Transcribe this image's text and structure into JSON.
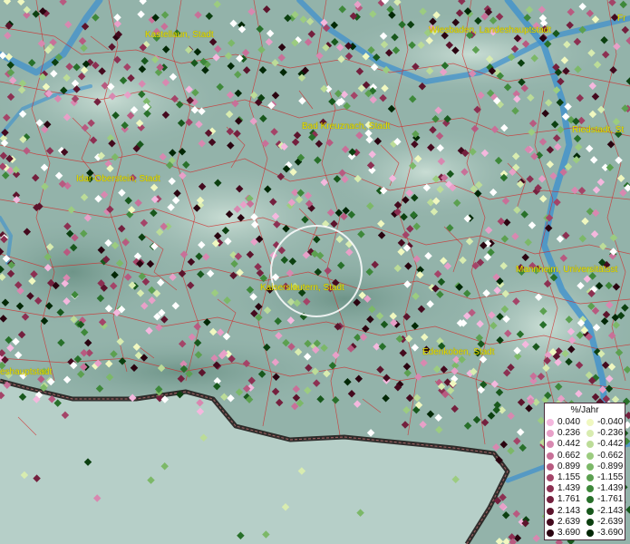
{
  "map": {
    "places": [
      {
        "id": "kastellaun",
        "label": "Kastellaun, Stadt"
      },
      {
        "id": "wiesbaden",
        "label": "Wiesbaden, Landeshauptstadt"
      },
      {
        "id": "frankfurt",
        "label": "Fr"
      },
      {
        "id": "bad-kreuznach",
        "label": "Bad Kreuznach, Stadt"
      },
      {
        "id": "riedstadt",
        "label": "Riedstadt, St"
      },
      {
        "id": "idar-oberstein",
        "label": "Idar-Oberstein, Stadt"
      },
      {
        "id": "kaiserslautern",
        "label": "Kaiserslautern, Stadt"
      },
      {
        "id": "mannheim",
        "label": "Mannheim, Universitätsst"
      },
      {
        "id": "edenkoben",
        "label": "Edenkoben, Stadt"
      },
      {
        "id": "saarbruecken",
        "label": "eshauptstadt"
      }
    ],
    "colors": {
      "river": "#3a8fcf",
      "border": "#d22828",
      "hills": "#9fc0b8",
      "country_border": "#1a1212"
    }
  },
  "legend": {
    "title": "%/Jahr",
    "positive": [
      {
        "value": "0.040",
        "color": "#f4b8de"
      },
      {
        "value": "0.236",
        "color": "#e8a0c8"
      },
      {
        "value": "0.442",
        "color": "#d888b0"
      },
      {
        "value": "0.662",
        "color": "#c87098"
      },
      {
        "value": "0.899",
        "color": "#b85a80"
      },
      {
        "value": "1.155",
        "color": "#a44468"
      },
      {
        "value": "1.439",
        "color": "#8c3052"
      },
      {
        "value": "1.761",
        "color": "#74203e"
      },
      {
        "value": "2.143",
        "color": "#5c142c"
      },
      {
        "value": "2.639",
        "color": "#440a1e"
      },
      {
        "value": "3.690",
        "color": "#2a0410"
      }
    ],
    "negative": [
      {
        "value": "-0.040",
        "color": "#f0f8c0"
      },
      {
        "value": "-0.236",
        "color": "#d8ecb0"
      },
      {
        "value": "-0.442",
        "color": "#bcdc98"
      },
      {
        "value": "-0.662",
        "color": "#9ccc80"
      },
      {
        "value": "-0.899",
        "color": "#7cb868"
      },
      {
        "value": "-1.155",
        "color": "#5ca050"
      },
      {
        "value": "-1.439",
        "color": "#3e883a"
      },
      {
        "value": "-1.761",
        "color": "#28702a"
      },
      {
        "value": "-2.143",
        "color": "#18581c"
      },
      {
        "value": "-2.639",
        "color": "#0c4010"
      },
      {
        "value": "-3.690",
        "color": "#022806"
      }
    ]
  }
}
